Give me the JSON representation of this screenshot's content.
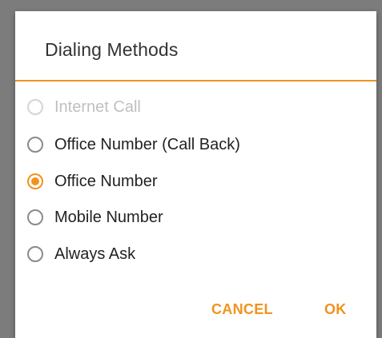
{
  "dialog": {
    "title": "Dialing Methods",
    "options": [
      {
        "label": "Internet Call",
        "state": "disabled"
      },
      {
        "label": "Office Number (Call Back)",
        "state": "unchecked"
      },
      {
        "label": "Office Number",
        "state": "checked"
      },
      {
        "label": "Mobile Number",
        "state": "unchecked"
      },
      {
        "label": "Always Ask",
        "state": "unchecked"
      }
    ],
    "cancel_label": "CANCEL",
    "ok_label": "OK"
  },
  "colors": {
    "accent": "#f0931e",
    "scrim": "#7f7f7f",
    "text": "#222222",
    "disabled_text": "#c0c0c0"
  }
}
